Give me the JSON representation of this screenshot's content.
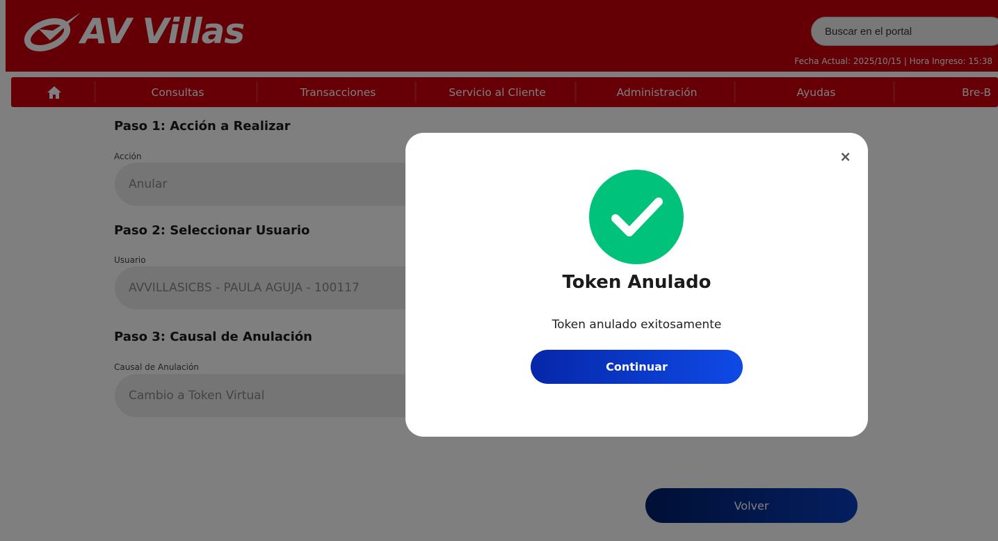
{
  "header": {
    "logo_text": "AV Villas",
    "search_placeholder": "Buscar en el portal",
    "datetime": "Fecha Actual: 2025/10/15 | Hora Ingreso: 15:38"
  },
  "nav": {
    "home_icon": "home-icon",
    "items": [
      "Consultas",
      "Transacciones",
      "Servicio al Cliente",
      "Administración",
      "Ayudas",
      "Bre-B"
    ]
  },
  "form": {
    "step1": {
      "title": "Paso 1: Acción a Realizar",
      "label": "Acción",
      "value": "Anular"
    },
    "step2": {
      "title": "Paso 2: Seleccionar Usuario",
      "label": "Usuario",
      "value": "AVVILLASICBS - PAULA AGUJA - 100117"
    },
    "step3": {
      "title": "Paso 3: Causal de Anulación",
      "label": "Causal de Anulación",
      "value": "Cambio a Token Virtual"
    },
    "back_button": "Volver"
  },
  "modal": {
    "close_label": "×",
    "icon": "check-circle-icon",
    "title": "Token Anulado",
    "message": "Token anulado exitosamente",
    "button": "Continuar"
  },
  "colors": {
    "brand_red": "#c8000b",
    "success_green": "#00c27a",
    "button_blue": "#0a3dbf"
  }
}
